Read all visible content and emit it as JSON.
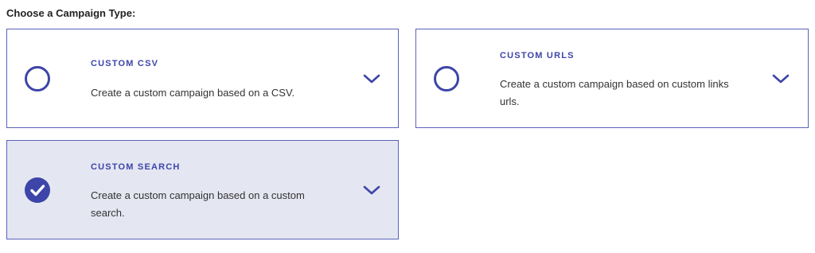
{
  "heading": "Choose a Campaign Type:",
  "accent_color": "#3d45a8",
  "selected_bg": "#e4e6f2",
  "options": [
    {
      "title": "CUSTOM CSV",
      "description": "Create a custom campaign based on a CSV.",
      "selected": false,
      "icon": "radio-unchecked-icon"
    },
    {
      "title": "CUSTOM URLS",
      "description": "Create a custom campaign based on custom links urls.",
      "selected": false,
      "icon": "radio-unchecked-icon"
    },
    {
      "title": "CUSTOM SEARCH",
      "description": "Create a custom campaign based on a custom search.",
      "selected": true,
      "icon": "check-circle-icon"
    }
  ]
}
